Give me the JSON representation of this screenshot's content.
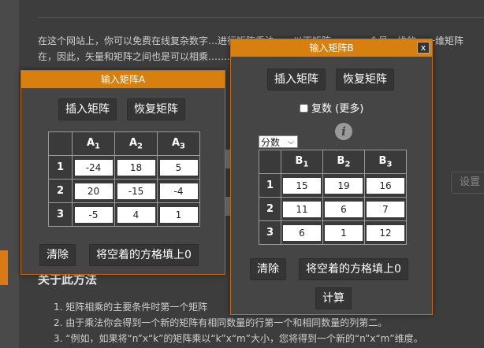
{
  "background": {
    "intro_line1": "在这个网站上，你可以免费在线复杂数字…进行矩阵乘法。…以不矩阵…，…一个是一维的，一维矩阵",
    "intro_line2": "在，因此，矢量和矩阵之间也是可以相乘…………………………………………一个矩阵的",
    "section_title": "关于此方法",
    "list": [
      "1. 矩阵相乘的主要条件时第一个矩阵",
      "2. 由于乘法你会得到一个新的矩阵有相同数量的行第一个和相同数量的列第二。",
      "3. “例如，如果将“n”x“k”的矩阵乘以“k”x“m”大小，您将得到一个新的“n”x“m”维度。"
    ],
    "settings_label": "设置"
  },
  "matrixA": {
    "title": "输入矩阵A",
    "insert_label": "插入矩阵",
    "restore_label": "恢复矩阵",
    "col_headers": [
      "A",
      "A",
      "A"
    ],
    "col_subs": [
      "1",
      "2",
      "3"
    ],
    "row_headers": [
      "1",
      "2",
      "3"
    ],
    "cells": [
      [
        "-24",
        "18",
        "5"
      ],
      [
        "20",
        "-15",
        "-4"
      ],
      [
        "-5",
        "4",
        "1"
      ]
    ],
    "clear_label": "清除",
    "fill_zero_label": "将空着的方格填上0"
  },
  "matrixB": {
    "title": "输入矩阵B",
    "close_label": "x",
    "insert_label": "插入矩阵",
    "restore_label": "恢复矩阵",
    "complex_label": "复数 (更多)",
    "info_glyph": "i",
    "format_value": "分数",
    "col_headers": [
      "B",
      "B",
      "B"
    ],
    "col_subs": [
      "1",
      "2",
      "3"
    ],
    "row_headers": [
      "1",
      "2",
      "3"
    ],
    "cells": [
      [
        "15",
        "19",
        "16"
      ],
      [
        "11",
        "6",
        "7"
      ],
      [
        "6",
        "1",
        "12"
      ]
    ],
    "clear_label": "清除",
    "fill_zero_label": "将空着的方格填上0",
    "calc_label": "计算"
  },
  "colors": {
    "accent": "#d8800f",
    "dialog_bg": "#454545"
  }
}
